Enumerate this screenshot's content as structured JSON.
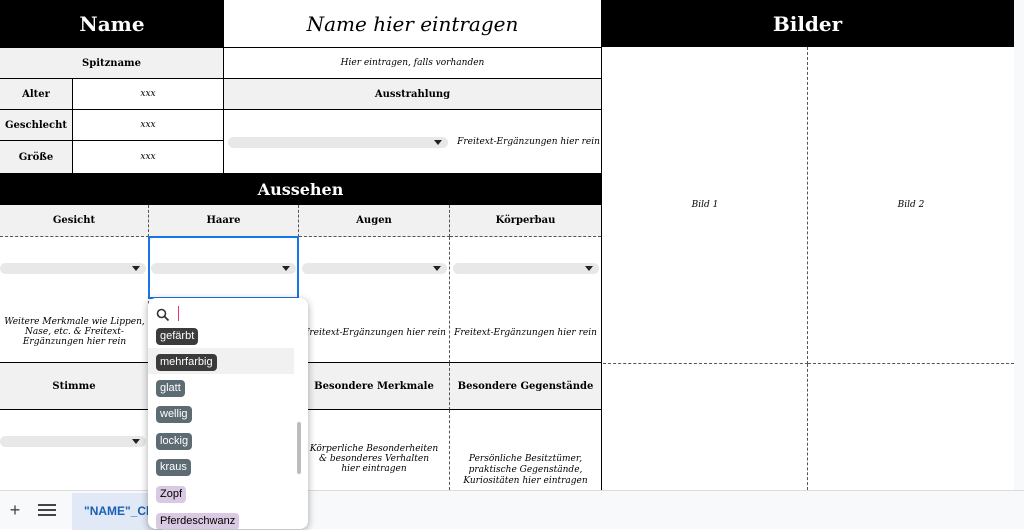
{
  "header": {
    "name_label": "Name",
    "name_value": "Name hier eintragen",
    "images_title": "Bilder"
  },
  "profile": {
    "nickname_label": "Spitzname",
    "nickname_value": "Hier eintragen, falls vorhanden",
    "age_label": "Alter",
    "age_value": "xxx",
    "gender_label": "Geschlecht",
    "gender_value": "xxx",
    "height_label": "Größe",
    "height_value": "xxx",
    "charisma_label": "Ausstrahlung",
    "charisma_text": "Freitext-Ergänzungen hier rein"
  },
  "appearance": {
    "title": "Aussehen",
    "columns": [
      "Gesicht",
      "Haare",
      "Augen",
      "Körperbau"
    ],
    "notes": [
      "Weitere Merkmale wie Lippen, Nase, etc. & Freitext-Ergänzungen hier rein",
      "",
      "Freitext-Ergänzungen hier rein",
      "Freitext-Ergänzungen hier rein"
    ]
  },
  "lower": {
    "voice_label": "Stimme",
    "features_label": "Besondere Merkmale",
    "items_label": "Besondere Gegenstände",
    "features_text": "Körperliche Besonderheiten & besonderes Verhalten hier eintragen",
    "items_text": "Persönliche Besitztümer, praktische Gegenstände, Kuriositäten hier eintragen"
  },
  "images": {
    "image1": "Bild 1",
    "image2": "Bild 2"
  },
  "dropdown": {
    "search_value": "",
    "options": [
      {
        "label": "gefärbt",
        "bg": "#3b3b3b",
        "fg": "#ffffff"
      },
      {
        "label": "mehrfarbig",
        "bg": "#3b3b3b",
        "fg": "#ffffff"
      },
      {
        "label": "glatt",
        "bg": "#5d6b73",
        "fg": "#ffffff"
      },
      {
        "label": "wellig",
        "bg": "#5d6b73",
        "fg": "#ffffff"
      },
      {
        "label": "lockig",
        "bg": "#5d6b73",
        "fg": "#ffffff"
      },
      {
        "label": "kraus",
        "bg": "#5d6b73",
        "fg": "#ffffff"
      },
      {
        "label": "Zopf",
        "bg": "#d9c9e3",
        "fg": "#000000"
      },
      {
        "label": "Pferdeschwanz",
        "bg": "#d9c9e3",
        "fg": "#000000"
      }
    ]
  },
  "tabbar": {
    "add_icon": "plus-icon",
    "menu_icon": "menu-icon",
    "sheet_tab_label": "\"NAME\"_Ch"
  }
}
